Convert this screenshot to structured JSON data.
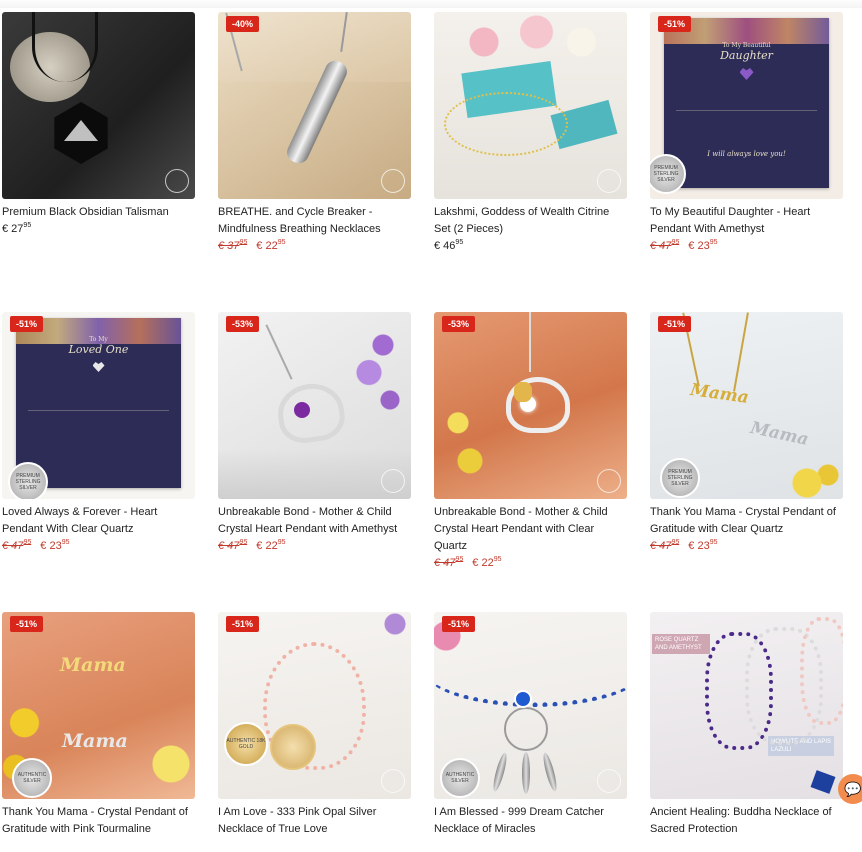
{
  "products": [
    {
      "title": "Premium Black Obsidian Talisman",
      "badge": "",
      "old_price": "",
      "old_cents": "",
      "price": "€ 27",
      "cents": "95",
      "image": "obsidian-talisman"
    },
    {
      "title": "BREATHE. and Cycle Breaker - Mindfulness Breathing Necklaces",
      "badge": "-40%",
      "old_price": "€ 37",
      "old_cents": "95",
      "price": "€ 22",
      "cents": "95",
      "image": "breathing-necklace"
    },
    {
      "title": "Lakshmi, Goddess of Wealth Citrine Set (2 Pieces)",
      "badge": "",
      "old_price": "",
      "old_cents": "",
      "price": "€ 46",
      "cents": "95",
      "image": "citrine-set"
    },
    {
      "title": "To My Beautiful Daughter - Heart Pendant With Amethyst",
      "badge": "-51%",
      "old_price": "€ 47",
      "old_cents": "95",
      "price": "€ 23",
      "cents": "95",
      "image": "daughter-card"
    },
    {
      "title": "Loved Always & Forever - Heart Pendant With Clear Quartz",
      "badge": "-51%",
      "old_price": "€ 47",
      "old_cents": "95",
      "price": "€ 23",
      "cents": "95",
      "image": "loved-one-card"
    },
    {
      "title": "Unbreakable Bond - Mother & Child Crystal Heart Pendant with Amethyst",
      "badge": "-53%",
      "old_price": "€ 47",
      "old_cents": "95",
      "price": "€ 22",
      "cents": "95",
      "image": "heart-amethyst"
    },
    {
      "title": "Unbreakable Bond - Mother & Child Crystal Heart Pendant with Clear Quartz",
      "badge": "-53%",
      "old_price": "€ 47",
      "old_cents": "95",
      "price": "€ 22",
      "cents": "95",
      "image": "heart-quartz"
    },
    {
      "title": "Thank You Mama - Crystal Pendant of Gratitude with Clear Quartz",
      "badge": "-51%",
      "old_price": "€ 47",
      "old_cents": "95",
      "price": "€ 23",
      "cents": "95",
      "image": "mama-necklace-silver"
    },
    {
      "title": "Thank You Mama - Crystal Pendant of Gratitude with Pink Tourmaline",
      "badge": "-51%",
      "old_price": "",
      "old_cents": "",
      "price": "",
      "cents": "",
      "image": "mama-necklace-gold"
    },
    {
      "title": "I Am Love - 333 Pink Opal Silver Necklace of True Love",
      "badge": "-51%",
      "old_price": "",
      "old_cents": "",
      "price": "",
      "cents": "",
      "image": "pink-opal"
    },
    {
      "title": "I Am Blessed - 999 Dream Catcher Necklace of Miracles",
      "badge": "-51%",
      "old_price": "",
      "old_cents": "",
      "price": "",
      "cents": "",
      "image": "dream-catcher"
    },
    {
      "title": "Ancient Healing: Buddha Necklace of Sacred Protection",
      "badge": "",
      "old_price": "",
      "old_cents": "",
      "price": "",
      "cents": "",
      "image": "buddha-necklace"
    }
  ],
  "card_text": {
    "daughter_heading": "To My Beautiful",
    "daughter_name": "Daughter",
    "daughter_closing": "I will always love you!",
    "loved_heading": "To My",
    "loved_name": "Loved One",
    "seal": "PREMIUM STERLING SILVER",
    "seal_gold": "AUTHENTIC 18K GOLD",
    "seal_silver": "AUTHENTIC SILVER",
    "mama": "Mama",
    "rose_label": "ROSE QUARTZ AND AMETHYST",
    "howlite_label": "HOWLITE AND LAPIS LAZULI"
  },
  "colors": {
    "sale_badge": "#d8261b",
    "price_red": "#c0392b",
    "chat_button": "#f28b4e"
  }
}
